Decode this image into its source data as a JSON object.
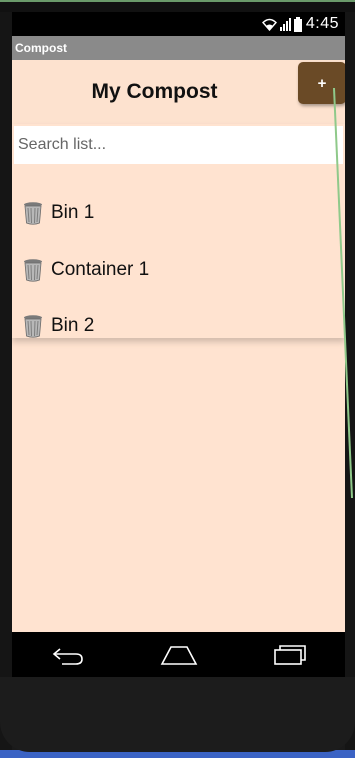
{
  "status_bar": {
    "time": "4:45"
  },
  "app": {
    "title": "Compost"
  },
  "header": {
    "title": "My Compost",
    "add_label": "+"
  },
  "search": {
    "placeholder": "Search list..."
  },
  "list": {
    "items": [
      {
        "label": "Bin 1",
        "icon": "trash-can-icon"
      },
      {
        "label": "Container 1",
        "icon": "trash-can-icon"
      },
      {
        "label": "Bin 2",
        "icon": "trash-can-icon"
      }
    ]
  },
  "colors": {
    "screen_background": "#ffe3d0",
    "add_button": "#6a4a26",
    "title_bar": "#8a8a8a",
    "nav_bar": "#000000"
  }
}
